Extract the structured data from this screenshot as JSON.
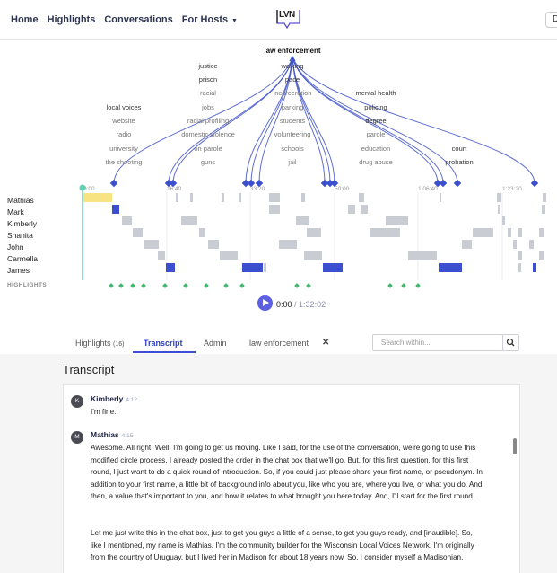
{
  "nav": {
    "links": [
      "Home",
      "Highlights",
      "Conversations",
      "For Hosts"
    ],
    "logo": "LVN",
    "user_initial": "D"
  },
  "topics": {
    "selected": "law enforcement",
    "column1": [
      "local voices",
      "website",
      "radio",
      "university",
      "the shooting"
    ],
    "column2": [
      "justice",
      "prison",
      "racial",
      "jobs",
      "racial profiling",
      "domestic violence",
      "on parole",
      "guns"
    ],
    "column3": [
      "walking",
      "pace",
      "incarceration",
      "parking",
      "students",
      "volunteering",
      "schools",
      "jail"
    ],
    "column4": [
      "mental health",
      "policing",
      "degree",
      "parole",
      "education",
      "drug abuse"
    ],
    "column5": [
      "court",
      "probation"
    ]
  },
  "timeline": {
    "ticks": [
      "0:00",
      "16:40",
      "33:20",
      "50:00",
      "1:06:40",
      "1:23:20"
    ],
    "speakers": [
      "Mathias",
      "Mark",
      "Kimberly",
      "Shanita",
      "John",
      "Carmella",
      "James"
    ],
    "highlights_label": "HIGHLIGHTS"
  },
  "player": {
    "current": "0:00",
    "separator": " / ",
    "duration": "1:32:02"
  },
  "tabs": {
    "highlights": "Highlights",
    "highlights_count": "(16)",
    "transcript": "Transcript",
    "admin": "Admin",
    "filter": "law enforcement",
    "close": "✕"
  },
  "search": {
    "placeholder": "Search within..."
  },
  "transcript": {
    "heading": "Transcript",
    "entries": [
      {
        "initial": "K",
        "speaker": "Kimberly",
        "time": "4:12",
        "paragraphs": [
          "I'm fine."
        ]
      },
      {
        "initial": "M",
        "speaker": "Mathias",
        "time": "4:15",
        "paragraphs": [
          "Awesome. All right. Well, I'm going to get us moving. Like I said, for the use of the conversation, we're going to use this modified circle process. I already posted the order in the chat box that we'll go. But, for this first question, for this first round, I just want to do a quick round of introduction. So, if you could just please share your first name, or pseudonym. In addition to your first name, a little bit of background info about you, like who you are, where you live, or what you do. And then, a value that's important to you, and how it relates to what brought you here today. And, I'll start for the first round.",
          "Let me just write this in the chat box, just to get you guys a little of a sense, to get you guys ready, and [inaudible]. So, like I mentioned, my name is Mathias. I'm the community builder for the Wisconsin Local Voices Network. I'm originally from the country of Uruguay, but I lived her in Madison for about 18 years now. So, I consider myself a Madisonian."
        ]
      }
    ]
  },
  "colors": {
    "accent": "#3b4fcf",
    "play": "#5b5fe0",
    "mathias": "#f7e382",
    "segment": "#c9ccd3",
    "highlight": "#3dbb6c",
    "playhead": "#5fd3b4"
  }
}
